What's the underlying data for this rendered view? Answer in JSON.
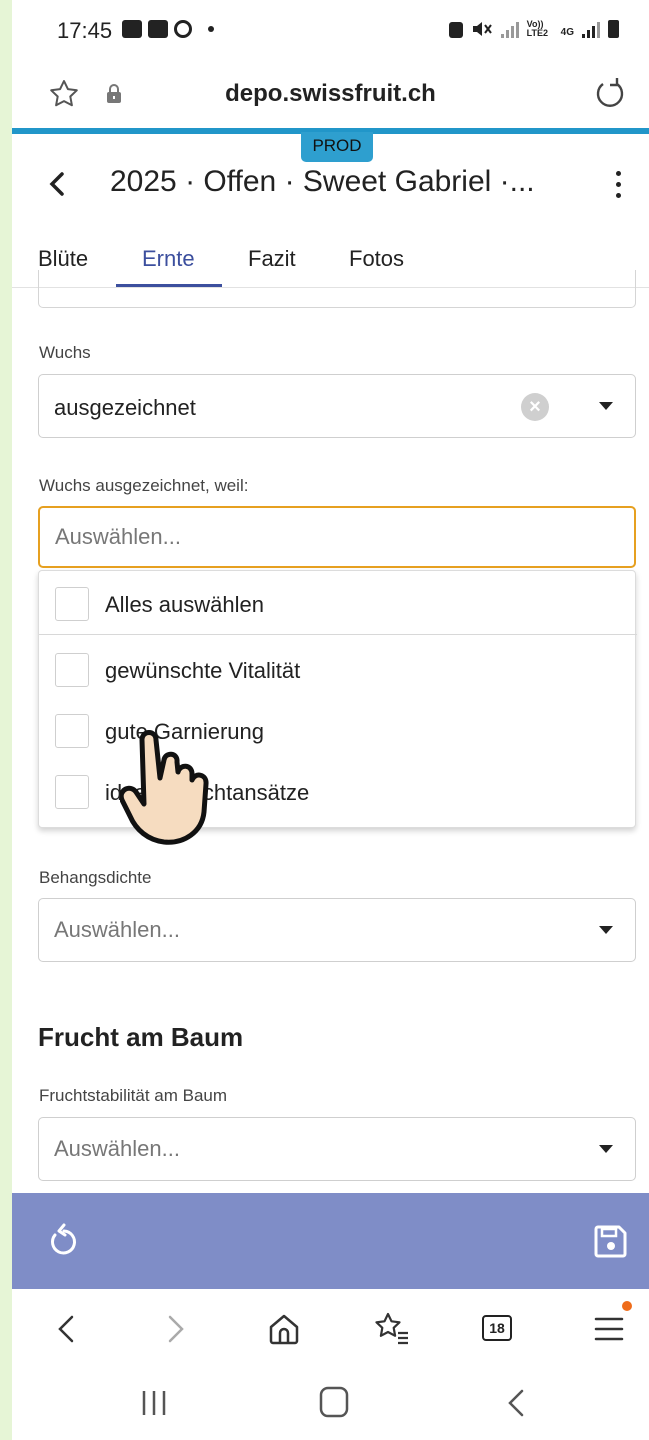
{
  "status_bar": {
    "time": "17:45",
    "network_label_1": "Vo)) LTE2",
    "network_label_2": "4G"
  },
  "browser": {
    "url": "depo.swissfruit.ch",
    "tab_count": "18"
  },
  "app": {
    "env_badge": "PROD",
    "back_label": "<",
    "title": "2025 · Offen · Sweet Gabriel ·...",
    "tabs": [
      {
        "label": "Blüte",
        "active": false
      },
      {
        "label": "Ernte",
        "active": true
      },
      {
        "label": "Fazit",
        "active": false
      },
      {
        "label": "Fotos",
        "active": false
      }
    ]
  },
  "form": {
    "wuchs": {
      "label": "Wuchs",
      "value": "ausgezeichnet"
    },
    "wuchs_reason": {
      "label": "Wuchs ausgezeichnet, weil:",
      "placeholder": "Auswählen...",
      "options": [
        {
          "label": "Alles auswählen",
          "checked": false
        },
        {
          "label": "gewünschte Vitalität",
          "checked": false
        },
        {
          "label": "gute Garnierung",
          "checked": false
        },
        {
          "label": "ideale Fruchtansätze",
          "checked": false
        }
      ]
    },
    "behangsdichte": {
      "label": "Behangsdichte",
      "placeholder": "Auswählen..."
    },
    "section_frucht": "Frucht am Baum",
    "fruchtstabilitaet": {
      "label": "Fruchtstabilität am Baum",
      "placeholder": "Auswählen..."
    }
  },
  "colors": {
    "accent": "#3c4f9e",
    "action_bar": "#7f8dc7",
    "focus_border": "#e6a020",
    "progress": "#2196c9",
    "badge": "#2e9fcf"
  },
  "icons": {
    "undo": "undo-icon",
    "save": "save-icon",
    "reload": "reload-icon",
    "favorite": "star-icon"
  }
}
